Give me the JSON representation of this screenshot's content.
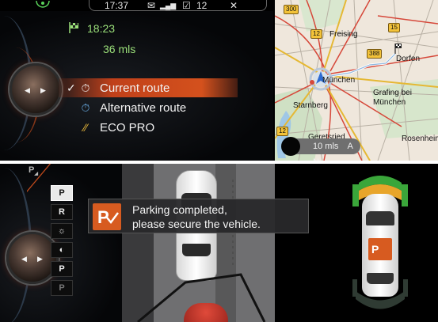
{
  "status_bar": {
    "time": "17:37",
    "count": "12"
  },
  "navigation": {
    "arrival_time": "18:23",
    "distance": "36 mls",
    "routes": [
      {
        "label": "Current route",
        "selected": true,
        "check": "✓"
      },
      {
        "label": "Alternative route",
        "selected": false
      },
      {
        "label": "ECO PRO",
        "selected": false
      }
    ]
  },
  "map": {
    "cities": [
      "Freising",
      "Dorfen",
      "München",
      "Starnberg",
      "Grafing bei München",
      "Geretsried",
      "Rosenheim"
    ],
    "road_numbers": [
      "300",
      "15",
      "12",
      "388",
      "12"
    ],
    "scale": "10 mls",
    "compass": "A N"
  },
  "parking": {
    "message_line1": "Parking completed,",
    "message_line2": "please secure the vehicle.",
    "menu_icons": [
      {
        "name": "park-assist",
        "label": "P",
        "active": true
      },
      {
        "name": "rear-camera",
        "label": "R",
        "active": false
      },
      {
        "name": "brightness",
        "label": "☼",
        "active": false
      },
      {
        "name": "contrast",
        "label": "◐",
        "active": false
      },
      {
        "name": "pdc",
        "label": "P",
        "active": false
      },
      {
        "name": "park-assist-off",
        "label": "P",
        "active": false
      }
    ]
  },
  "colors": {
    "accent": "#d4511d",
    "green_sensor": "#3aa63a",
    "orange_sensor": "#e8a52b",
    "map_bg": "#efe7dc",
    "road": "#6f6f71"
  }
}
